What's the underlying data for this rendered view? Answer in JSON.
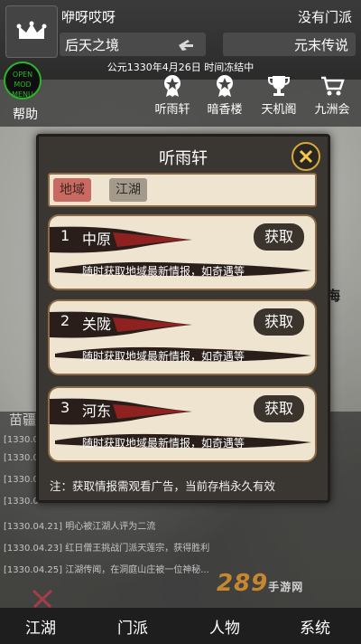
{
  "player": {
    "name": "咿呀哎呀",
    "sect": "没有门派",
    "realm": "后天之境",
    "item": "元末传说",
    "date_status": "公元1330年4月26日 时间冻结中"
  },
  "nav_top": {
    "mod_menu": "OPEN\nMOD MENU",
    "help": "帮助",
    "items": [
      "听雨轩",
      "暗香楼",
      "天机阁",
      "九洲会"
    ]
  },
  "map": {
    "label_sea": "海",
    "label_region": "苗"
  },
  "dialog": {
    "title": "听雨轩",
    "tabs": [
      "地域",
      "江湖"
    ],
    "cards": [
      {
        "num": "1",
        "region": "中原",
        "button": "获取",
        "desc": "随时获取地域最新情报，如奇遇等"
      },
      {
        "num": "2",
        "region": "关陇",
        "button": "获取",
        "desc": "随时获取地域最新情报，如奇遇等"
      },
      {
        "num": "3",
        "region": "河东",
        "button": "获取",
        "desc": "随时获取地域最新情报，如奇遇等"
      }
    ],
    "note": "注：获取情报需观看广告，当前存档永久有效"
  },
  "log": {
    "title": "苗疆",
    "lines": [
      "[1330.0",
      "[1330.0",
      "[1330.0",
      "[1330.0",
      "[1330.04.21] 明心被江湖人评为二流",
      "[1330.04.23] 红日僧王挑战门派天莲宗，获得胜利",
      "[1330.04.25] 江湖传闻，在洞庭山庄被一位神秘..."
    ]
  },
  "watermark": {
    "main": "289",
    "sub": "手游网"
  },
  "bottom_nav": [
    "江湖",
    "门派",
    "人物",
    "系统"
  ],
  "colors": {
    "accent_gold": "#d7a93a",
    "tab_active": "#c86a62",
    "mod_green": "#2ab52a",
    "brush_red": "#8f2220"
  }
}
